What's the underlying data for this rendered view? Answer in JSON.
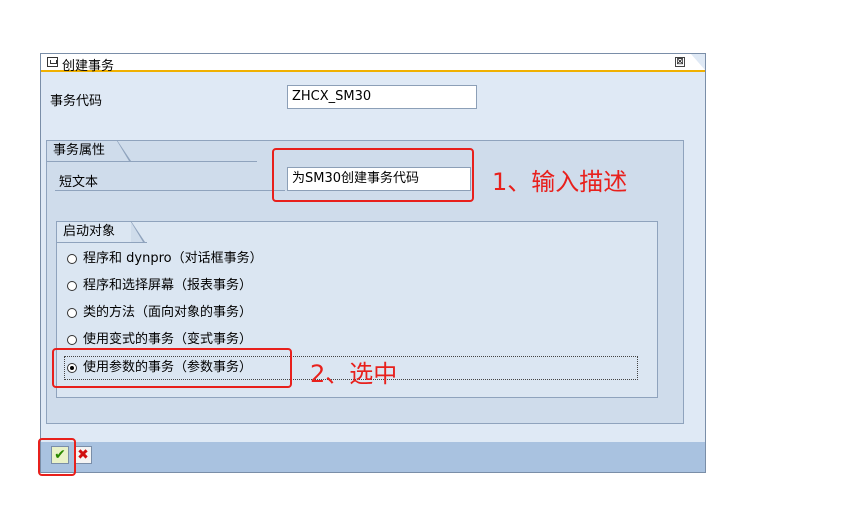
{
  "dialog": {
    "title": "创建事务",
    "close_glyph": "⊠"
  },
  "tcode": {
    "label": "事务代码",
    "value": "ZHCX_SM30"
  },
  "attributes": {
    "group_title": "事务属性",
    "short_text_label": "短文本",
    "short_text_value": "为SM30创建事务代码"
  },
  "start_object": {
    "group_title": "启动对象",
    "options": [
      {
        "label": "程序和 dynpro（对话框事务）",
        "selected": false
      },
      {
        "label": "程序和选择屏幕（报表事务）",
        "selected": false
      },
      {
        "label": "类的方法（面向对象的事务）",
        "selected": false
      },
      {
        "label": "使用变式的事务（变式事务）",
        "selected": false
      },
      {
        "label": "使用参数的事务（参数事务）",
        "selected": true
      }
    ]
  },
  "footer": {
    "confirm_icon": "checkmark-icon",
    "cancel_icon": "cancel-x-icon",
    "confirm_glyph": "✔",
    "cancel_glyph": "✖"
  },
  "annotations": {
    "step1": "1、输入描述",
    "step2": "2、选中",
    "color": "#e8201c"
  }
}
